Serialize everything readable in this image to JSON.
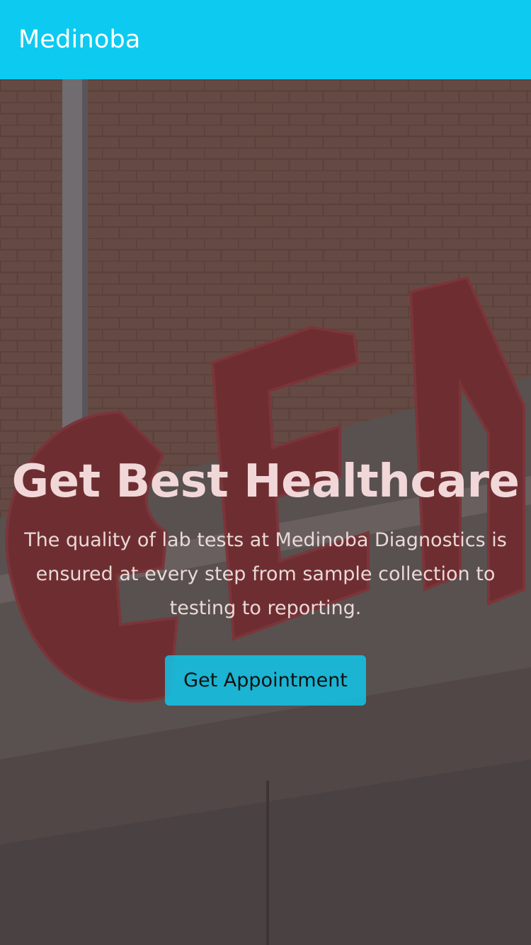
{
  "navbar": {
    "brand": "Medinoba"
  },
  "hero": {
    "title": "Get Best Healthcare",
    "description": "The quality of lab tests at Medinoba Diagnostics is ensured at every step from sample collection to testing to reporting.",
    "button_label": "Get Appointment"
  },
  "colors": {
    "accent": "#0dcaf0",
    "overlay": "#5a4a48"
  }
}
